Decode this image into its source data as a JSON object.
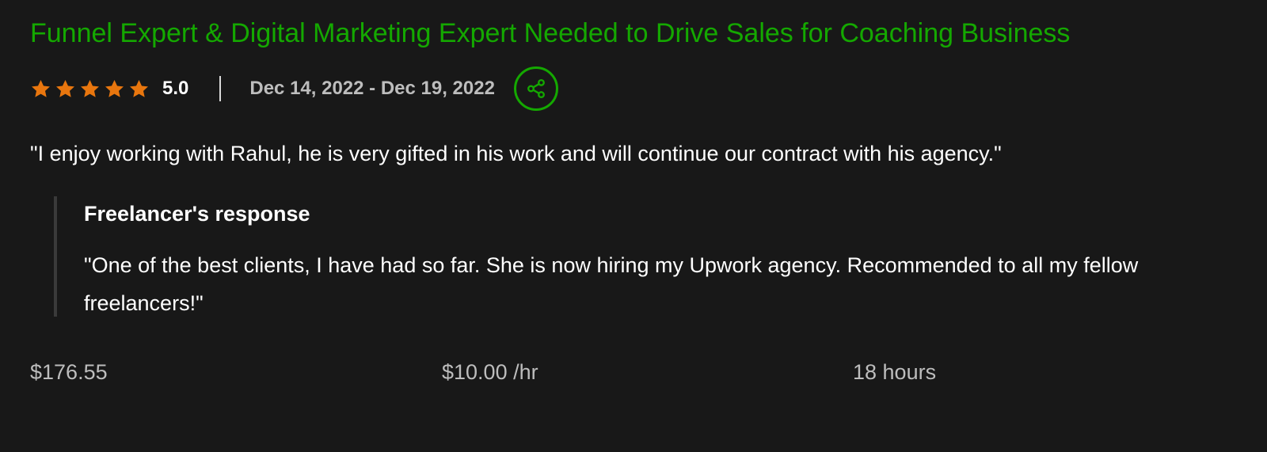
{
  "job": {
    "title": "Funnel Expert & Digital Marketing Expert Needed to Drive Sales for Coaching Business",
    "rating": {
      "stars": 5,
      "max_stars": 5,
      "value": "5.0"
    },
    "date_range": "Dec 14, 2022 - Dec 19, 2022",
    "share_icon": "share-icon"
  },
  "review": {
    "text": "\"I enjoy working with Rahul, he is very gifted in his work and will continue our contract with his agency.\""
  },
  "freelancer_response": {
    "heading": "Freelancer's response",
    "text": "\"One of the best clients, I have had so far. She is now hiring my Upwork agency. Recommended to all my fellow freelancers!\""
  },
  "stats": {
    "earned": "$176.55",
    "rate": "$10.00 /hr",
    "hours": "18 hours"
  },
  "colors": {
    "background": "#181818",
    "accent_green": "#14a800",
    "star_orange": "#e8760e",
    "muted_text": "#bdbdbd"
  }
}
